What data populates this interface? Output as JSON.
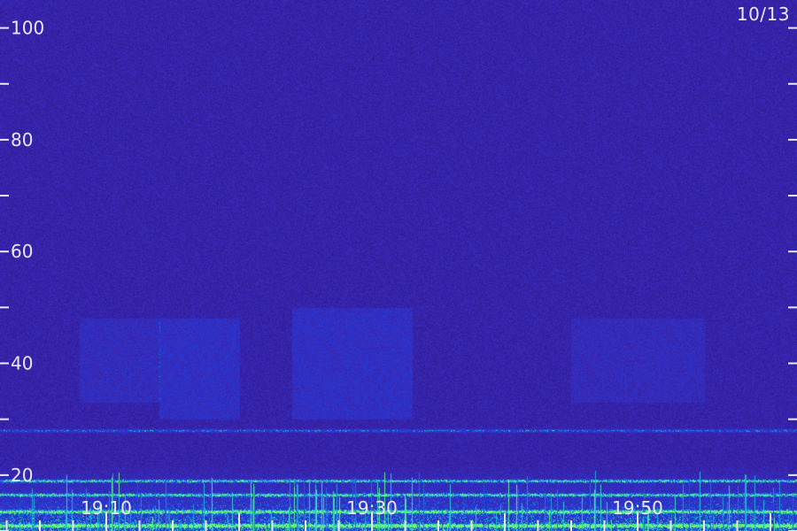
{
  "chart_data": {
    "type": "heatmap",
    "subtype": "spectrogram",
    "date_label": "10/13",
    "y_ticks": [
      20,
      40,
      60,
      80,
      100
    ],
    "y_range": [
      10,
      105
    ],
    "y_minor_step": 10,
    "x_tick_labels": [
      "19:10",
      "19:30",
      "19:50"
    ],
    "x_label_minutes": [
      10,
      30,
      50
    ],
    "x_range_minutes": [
      2,
      62
    ],
    "x_minor_step_minutes": 2.5,
    "grid": false,
    "colors": {
      "background": "#24106a",
      "noise_low": "#2a0f7a",
      "noise_high": "#3a2ab8",
      "band_mid": "#1e3fe0",
      "band_bright": "#22c8d8",
      "band_peak": "#6dff6a",
      "text": "#e8e8ff"
    },
    "horizontal_bands": [
      {
        "freq": 28,
        "intensity": 0.65
      },
      {
        "freq": 19,
        "intensity": 0.9
      },
      {
        "freq": 16.5,
        "intensity": 0.8
      },
      {
        "freq": 13.5,
        "intensity": 0.85
      },
      {
        "freq": 11,
        "intensity": 0.95
      }
    ],
    "diffuse_patches": [
      {
        "t_start": 8,
        "t_end": 14,
        "f_low": 33,
        "f_high": 48,
        "intensity": 0.35
      },
      {
        "t_start": 14,
        "t_end": 20,
        "f_low": 30,
        "f_high": 48,
        "intensity": 0.45
      },
      {
        "t_start": 24,
        "t_end": 33,
        "f_low": 30,
        "f_high": 50,
        "intensity": 0.45
      },
      {
        "t_start": 45,
        "t_end": 55,
        "f_low": 33,
        "f_high": 48,
        "intensity": 0.3
      }
    ]
  }
}
